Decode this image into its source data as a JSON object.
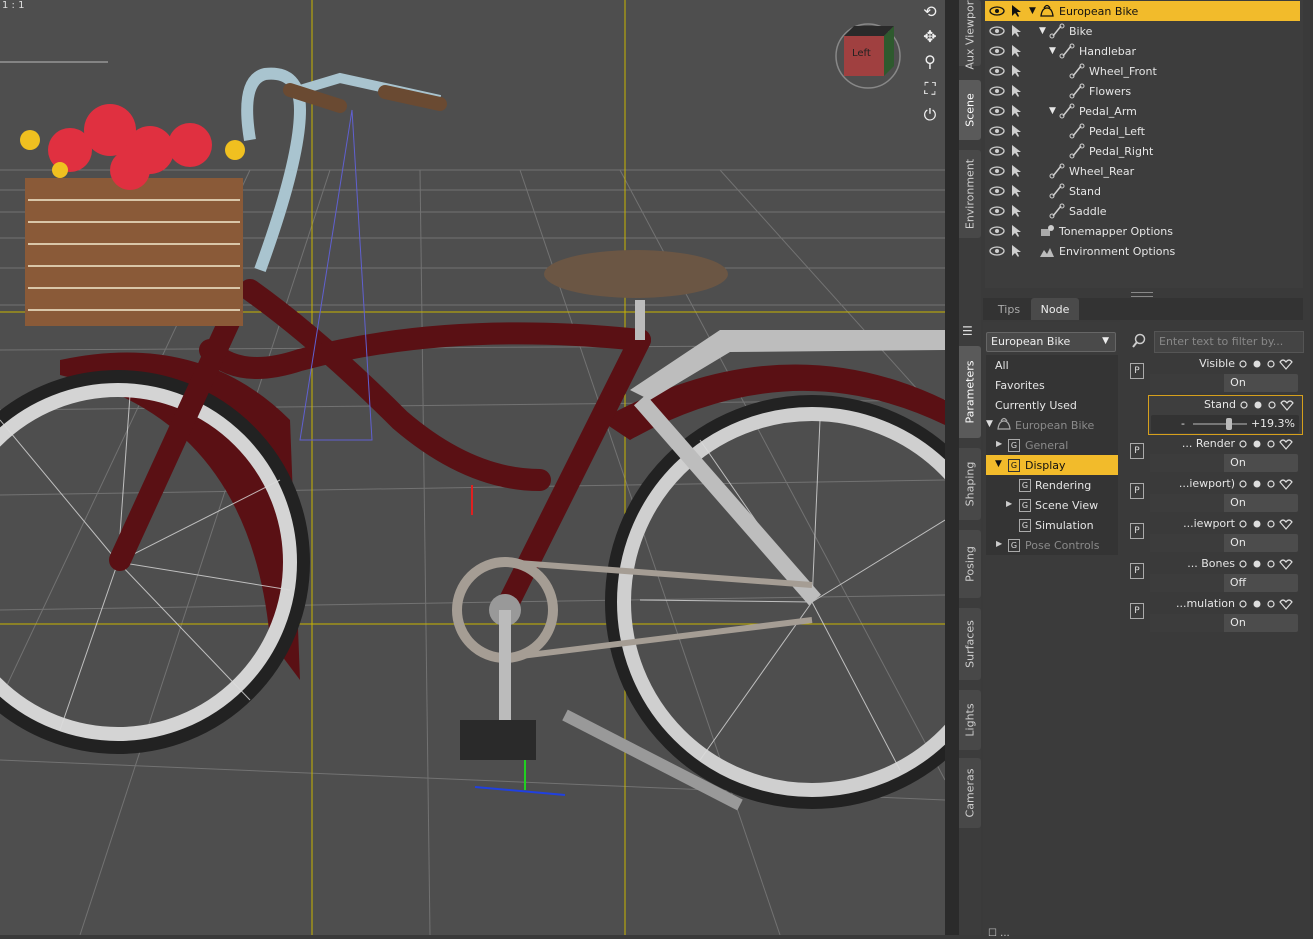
{
  "viewport": {
    "ratio_label": "1 : 1",
    "view_cube_label": "Left"
  },
  "vertical_tabs": [
    "Aux Viewport",
    "Scene",
    "Environment",
    "Parameters",
    "Shaping",
    "Posing",
    "Surfaces",
    "Lights",
    "Cameras"
  ],
  "scene_tree": [
    {
      "label": "European Bike",
      "icon": "figure-icon",
      "selected": true,
      "expand": "▼"
    },
    {
      "label": "Bike",
      "icon": "bone-icon",
      "selected": false,
      "expand": "▼"
    },
    {
      "label": "Handlebar",
      "icon": "bone-icon",
      "selected": false,
      "expand": "▼"
    },
    {
      "label": "Wheel_Front",
      "icon": "bone-icon",
      "selected": false,
      "expand": ""
    },
    {
      "label": "Flowers",
      "icon": "bone-icon",
      "selected": false,
      "expand": ""
    },
    {
      "label": "Pedal_Arm",
      "icon": "bone-icon",
      "selected": false,
      "expand": "▼"
    },
    {
      "label": "Pedal_Left",
      "icon": "bone-icon",
      "selected": false,
      "expand": ""
    },
    {
      "label": "Pedal_Right",
      "icon": "bone-icon",
      "selected": false,
      "expand": ""
    },
    {
      "label": "Wheel_Rear",
      "icon": "bone-icon",
      "selected": false,
      "expand": ""
    },
    {
      "label": "Stand",
      "icon": "bone-icon",
      "selected": false,
      "expand": ""
    },
    {
      "label": "Saddle",
      "icon": "bone-icon",
      "selected": false,
      "expand": ""
    },
    {
      "label": "Tonemapper Options",
      "icon": "tonemapper-icon",
      "selected": false,
      "expand": ""
    },
    {
      "label": "Environment Options",
      "icon": "environment-icon",
      "selected": false,
      "expand": ""
    }
  ],
  "bottom_tabs": {
    "tips": "Tips",
    "node": "Node"
  },
  "params": {
    "node_select": "European Bike",
    "filter_placeholder": "Enter text to filter by...",
    "groups": {
      "all": "All",
      "favorites": "Favorites",
      "currently_used": "Currently Used",
      "node": "European Bike",
      "general": "General",
      "display": "Display",
      "rendering": "Rendering",
      "scene_view": "Scene View",
      "simulation": "Simulation",
      "pose_controls": "Pose Controls"
    },
    "items": [
      {
        "name": "Visible",
        "value": "On"
      },
      {
        "name": "Stand",
        "value": "19.3%",
        "slider": 0.193
      },
      {
        "name": "... Render",
        "value": "On"
      },
      {
        "name": "...iewport)",
        "value": "On"
      },
      {
        "name": "...iewport",
        "value": "On"
      },
      {
        "name": "... Bones",
        "value": "Off"
      },
      {
        "name": "...mulation",
        "value": "On"
      }
    ]
  },
  "colors": {
    "selection": "#f2bb2b",
    "bike_frame": "#5a1014",
    "viewport_bg": "#4e4e4e"
  }
}
